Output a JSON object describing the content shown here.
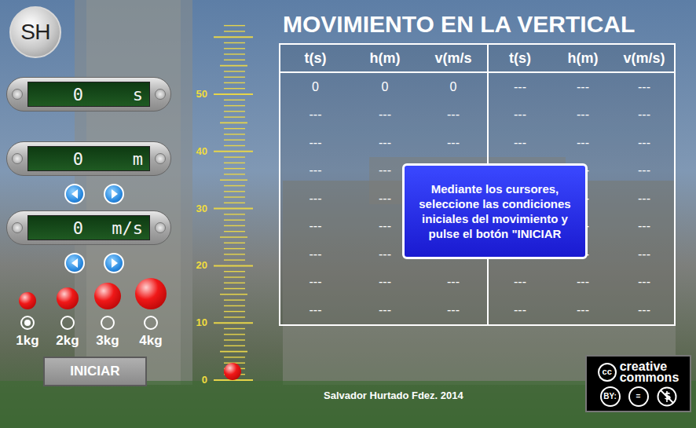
{
  "logo": "SH",
  "title": "MOVIMIENTO EN LA VERTICAL",
  "displays": [
    {
      "value": "0",
      "unit": "s",
      "adjustable": false
    },
    {
      "value": "0",
      "unit": "m",
      "adjustable": true
    },
    {
      "value": "0",
      "unit": "m/s",
      "adjustable": true
    }
  ],
  "ruler": {
    "labels": [
      "50",
      "40",
      "30",
      "20",
      "10",
      "0"
    ]
  },
  "ball": {
    "level": 0
  },
  "masses": [
    {
      "label": "1kg",
      "selected": true
    },
    {
      "label": "2kg",
      "selected": false
    },
    {
      "label": "3kg",
      "selected": false
    },
    {
      "label": "4kg",
      "selected": false
    }
  ],
  "button": "INICIAR",
  "table": {
    "columns": [
      "t(s)",
      "h(m)",
      "v(m/s",
      "t(s)",
      "h(m)",
      "v(m/s)"
    ],
    "rows": [
      [
        "0",
        "0",
        "0",
        "---",
        "---",
        "---"
      ],
      [
        "---",
        "---",
        "---",
        "---",
        "---",
        "---"
      ],
      [
        "---",
        "---",
        "---",
        "---",
        "---",
        "---"
      ],
      [
        "---",
        "---",
        "---",
        "---",
        "---",
        "---"
      ],
      [
        "---",
        "---",
        "---",
        "---",
        "---",
        "---"
      ],
      [
        "---",
        "---",
        "---",
        "---",
        "---",
        "---"
      ],
      [
        "---",
        "---",
        "---",
        "---",
        "---",
        "---"
      ],
      [
        "---",
        "---",
        "---",
        "---",
        "---",
        "---"
      ],
      [
        "---",
        "---",
        "---",
        "---",
        "---",
        "---"
      ]
    ]
  },
  "message": "Mediante los cursores, seleccione las condiciones iniciales del movimiento y pulse el botón \"INICIAR",
  "footer": "Salvador Hurtado Fdez. 2014",
  "license": {
    "cc": "cc",
    "brand": [
      "creative",
      "commons"
    ],
    "badges": [
      "BY:",
      "="
    ]
  }
}
